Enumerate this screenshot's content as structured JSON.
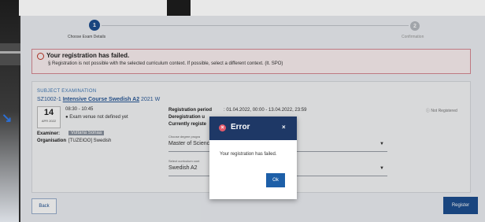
{
  "stepper": {
    "step1_number": "1",
    "step1_label": "Choose Exam Details",
    "step2_number": "2",
    "step2_label": "Confirmation"
  },
  "banner": {
    "title": "Your registration has failed.",
    "message": "§ Registration is not possible with the selected curriculum context. If possible, select a different context. (lt. SPO)"
  },
  "subject": {
    "heading": "SUBJECT EXAMINATION",
    "code": "SZ1002-1",
    "name": "Intensive Course Swedish A2",
    "term": "2021 W",
    "date_day": "14",
    "date_month": "APR 2022",
    "time": "08:30 - 10:45",
    "venue": "Exam venue not defined yet",
    "examiner_label": "Examiner:",
    "examiner_value": "Vultaria Sonaa",
    "organisation_label": "Organisation",
    "organisation_value": "[TUZEIOO] Swedish",
    "registration_period_label": "Registration period",
    "registration_period_value": ": 01.04.2022, 00:00 - 13.04.2022, 23:59",
    "deregistration_label": "Deregistration u",
    "currently_label": "Currently registe",
    "status": "Not Registered",
    "degree_field_label": "Choose degree progra",
    "degree_value": "Master of Scienc",
    "context_field_label": "Select curriculum cont",
    "context_value": "Swedish A2"
  },
  "buttons": {
    "back": "Back",
    "register": "Register"
  },
  "modal": {
    "title": "Error",
    "close": "×",
    "message": "Your registration has failed.",
    "ok": "Ok"
  },
  "colors": {
    "primary": "#1d4f91",
    "modal_header": "#1e3866",
    "error": "#c0392b"
  }
}
